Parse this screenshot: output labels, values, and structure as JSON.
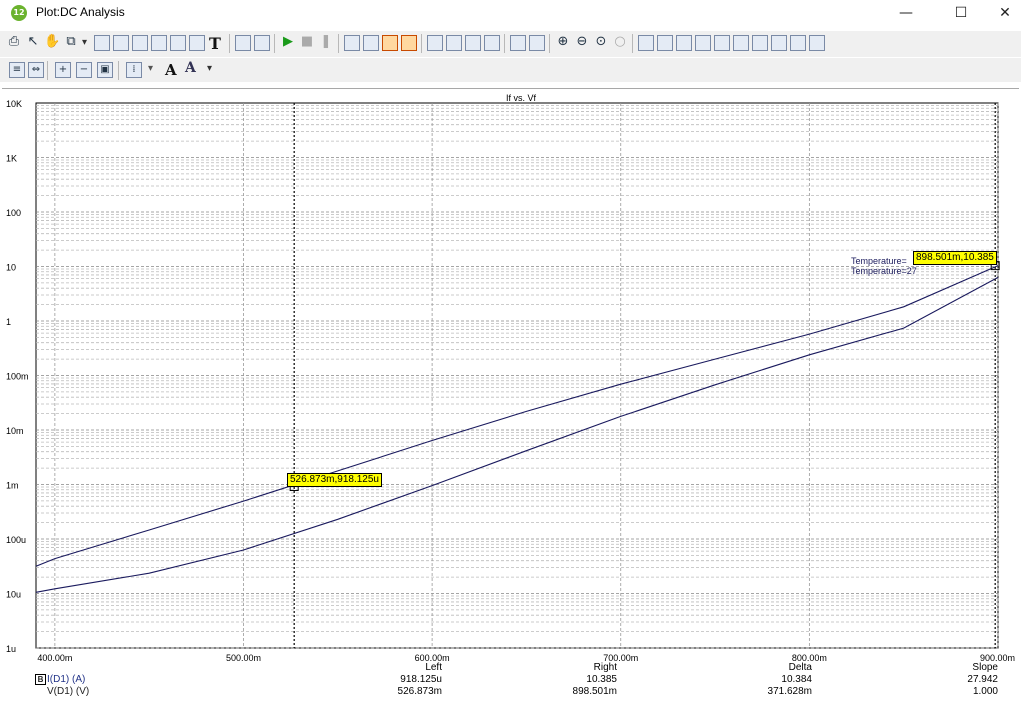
{
  "window": {
    "title": "Plot:DC Analysis",
    "app_icon_text": "12",
    "minimize_glyph": "—",
    "maximize_glyph": "☐",
    "close_glyph": "✕"
  },
  "toolbar": {
    "row1_icons": [
      "print-icon",
      "select-arrow-icon",
      "pan-hand-icon",
      "copy-icon",
      "dropdown-arrow-icon",
      "graph-window-icon",
      "zoom-window-icon",
      "zoom-box-icon",
      "zoom-extents-icon",
      "zoom-reset-icon",
      "zoom-previous-icon",
      "text-tool-icon",
      "trace-properties-icon",
      "export-icon",
      "run-icon",
      "stop-icon",
      "pause-icon",
      "scale-x-icon",
      "scale-y-icon",
      "cursor-box-icon",
      "cursor-box-red-icon",
      "layout-1-icon",
      "layout-2-icon",
      "layout-3-icon",
      "layout-4-icon",
      "tile-horizontal-icon",
      "tile-vertical-icon",
      "zoom-in-icon",
      "zoom-out-icon",
      "zoom-fit-icon",
      "zoom-disabled-icon",
      "cursor-next-icon",
      "cursor-prev-icon",
      "peak-icon",
      "valley-icon",
      "high-icon",
      "low-icon",
      "inflection-up-icon",
      "inflection-down-icon",
      "global-high-icon",
      "global-low-icon"
    ],
    "text_tool_label": "T",
    "font_label": "A",
    "font_size_label": "A",
    "dropdown_glyph": "▾"
  },
  "chart_data": {
    "type": "line",
    "title": "If vs. Vf",
    "xscale": "linear",
    "yscale": "log",
    "xlim": [
      0.39,
      0.9
    ],
    "ylim": [
      1e-06,
      10000
    ],
    "x_ticks": [
      "400.00m",
      "500.00m",
      "600.00m",
      "700.00m",
      "800.00m",
      "900.00m"
    ],
    "y_ticks": [
      "1u",
      "10u",
      "100u",
      "1m",
      "10m",
      "100m",
      "1",
      "10",
      "100",
      "1K",
      "10K"
    ],
    "grid": "on",
    "series": [
      {
        "name": "",
        "color": "#1a1a5e",
        "x": [
          0.39,
          0.4,
          0.45,
          0.5,
          0.55,
          0.6,
          0.65,
          0.7,
          0.75,
          0.8,
          0.85,
          0.9
        ],
        "y": [
          3.16e-05,
          4.36e-05,
          0.000146,
          0.000495,
          0.00178,
          0.00641,
          0.0219,
          0.0692,
          0.2,
          0.575,
          1.82,
          10.385
        ]
      },
      {
        "name": "Temperature=27",
        "color": "#1a1a5e",
        "x": [
          0.39,
          0.4,
          0.45,
          0.5,
          0.55,
          0.6,
          0.65,
          0.7,
          0.75,
          0.8,
          0.85,
          0.9
        ],
        "y": [
          1.05e-05,
          1.22e-05,
          2.36e-05,
          6.29e-05,
          0.00023,
          0.000955,
          0.00417,
          0.0178,
          0.0676,
          0.24,
          0.741,
          6.31
        ]
      }
    ],
    "cursors": [
      {
        "name": "Left",
        "x": 0.526873,
        "y_text": "526.873m,918.125u"
      },
      {
        "name": "Right",
        "x": 0.898501,
        "y_text": "898.501m,10.385"
      }
    ],
    "curve_labels": [
      "Temperature=",
      "Temperature=27"
    ],
    "footer": {
      "headers": [
        "Left",
        "Right",
        "Delta",
        "Slope"
      ],
      "row1": {
        "label": "I(D1) (A)",
        "marker": "B",
        "values": [
          "918.125u",
          "10.385",
          "10.384",
          "27.942"
        ]
      },
      "row2": {
        "label": "V(D1) (V)",
        "values": [
          "526.873m",
          "898.501m",
          "371.628m",
          "1.000"
        ]
      }
    }
  }
}
